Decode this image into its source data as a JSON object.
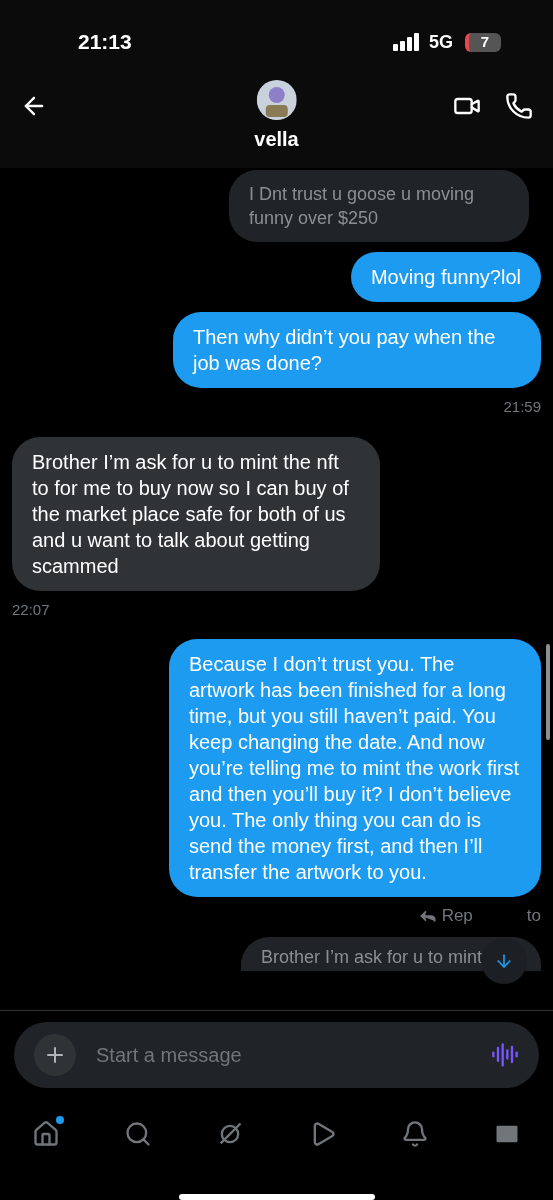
{
  "status_bar": {
    "time": "21:13",
    "network": "5G",
    "battery": "7"
  },
  "header": {
    "name": "vella"
  },
  "messages": [
    {
      "kind": "received",
      "text": "I Dnt trust u goose u moving funny over $250",
      "dimmed": true
    },
    {
      "kind": "sent",
      "text": "Moving funny?lol"
    },
    {
      "kind": "sent",
      "text": "Then why didn’t you pay when the job was done?",
      "time": "21:59"
    },
    {
      "kind": "received",
      "text": "Brother I’m ask for u to mint the nft to for me to buy now so I can buy of the market place safe for both of us and u want to talk about getting scammed",
      "time": "22:07"
    },
    {
      "kind": "sent",
      "text": "Because I don’t trust you. The artwork has been finished for a long time, but you still haven’t paid. You keep changing the date. And now you’re telling me to mint the work first and then you’ll buy it? I don’t believe you. The only thing you can do is send the money first, and then I’ll transfer the artwork to you."
    }
  ],
  "reply_note": {
    "before": "Rep",
    "after": "to"
  },
  "partial_message": {
    "text": "Brother I’m ask for u to mint"
  },
  "composer": {
    "placeholder": "Start a message"
  },
  "nav": [
    {
      "kind": "home",
      "badge": true
    },
    {
      "kind": "search",
      "badge": false
    },
    {
      "kind": "grok",
      "badge": false
    },
    {
      "kind": "video",
      "badge": false
    },
    {
      "kind": "bell",
      "badge": false
    },
    {
      "kind": "mail",
      "badge": false
    }
  ]
}
